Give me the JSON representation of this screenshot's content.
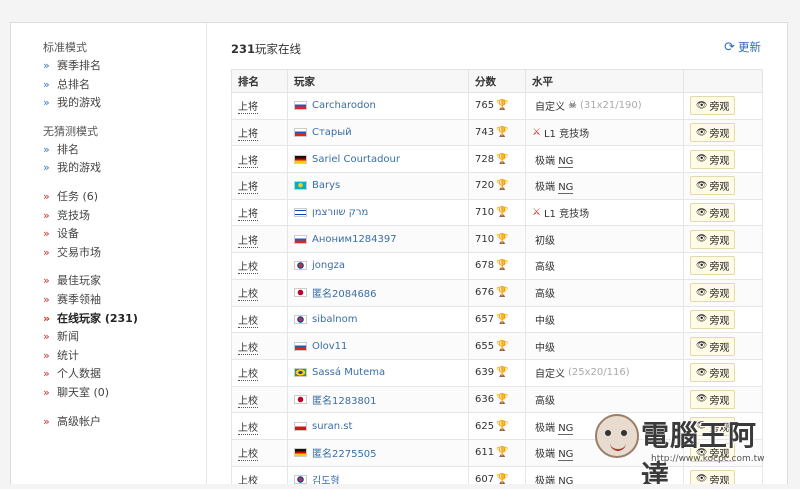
{
  "sidebar": {
    "groups": [
      {
        "title": "标准模式",
        "items": [
          {
            "label": "赛季排名",
            "bullet": "»"
          },
          {
            "label": "总排名",
            "bullet": "»"
          },
          {
            "label": "我的游戏",
            "bullet": "»"
          }
        ]
      },
      {
        "title": "无猜测模式",
        "items": [
          {
            "label": "排名",
            "bullet": "»"
          },
          {
            "label": "我的游戏",
            "bullet": "»"
          }
        ]
      },
      {
        "title": "",
        "items": [
          {
            "label": "任务 (6)",
            "bullet": "»"
          },
          {
            "label": "竞技场",
            "bullet": "»"
          },
          {
            "label": "设备",
            "bullet": "»"
          },
          {
            "label": "交易市场",
            "bullet": "»"
          }
        ]
      },
      {
        "title": "",
        "items": [
          {
            "label": "最佳玩家",
            "bullet": "»"
          },
          {
            "label": "赛季领袖",
            "bullet": "»"
          },
          {
            "label": "在线玩家 (231)",
            "bullet": "»"
          },
          {
            "label": "新闻",
            "bullet": "»"
          },
          {
            "label": "统计",
            "bullet": "»"
          },
          {
            "label": "个人数据",
            "bullet": "»"
          },
          {
            "label": "聊天室 (0)",
            "bullet": "»"
          }
        ]
      },
      {
        "title": "",
        "items": [
          {
            "label": "高级帐户",
            "bullet": "»"
          }
        ]
      }
    ]
  },
  "main": {
    "count": "231",
    "title_suffix": "玩家在线",
    "refresh_label": "更新",
    "refresh_icon": "refresh-icon"
  },
  "table": {
    "headers": [
      "排名",
      "玩家",
      "分数",
      "水平",
      ""
    ],
    "watch_label": "旁观",
    "rows": [
      {
        "rank": "上将",
        "flag": "russia",
        "player": "Carcharodon",
        "score": "765",
        "level": "自定义",
        "level_icon": "skull",
        "level_extra": "(31x21/190)",
        "underline": false
      },
      {
        "rank": "上将",
        "flag": "russia",
        "player": "Старый",
        "score": "743",
        "level": "L1 竞技场",
        "level_icon": "arena",
        "level_extra": "",
        "underline": false
      },
      {
        "rank": "上将",
        "flag": "germany",
        "player": "Sariel Courtadour",
        "score": "728",
        "level": "极端 NG",
        "level_icon": "",
        "level_extra": "",
        "underline": true
      },
      {
        "rank": "上将",
        "flag": "kazakhstan",
        "player": "Barys",
        "score": "720",
        "level": "极端 NG",
        "level_icon": "",
        "level_extra": "",
        "underline": true
      },
      {
        "rank": "上将",
        "flag": "israel",
        "player": "מרק שוורצמן",
        "score": "710",
        "level": "L1 竞技场",
        "level_icon": "arena",
        "level_extra": "",
        "underline": false
      },
      {
        "rank": "上将",
        "flag": "russia",
        "player": "Аноним1284397",
        "score": "710",
        "level": "初级",
        "level_icon": "",
        "level_extra": "",
        "underline": false
      },
      {
        "rank": "上校",
        "flag": "korea",
        "player": "jongza",
        "score": "678",
        "level": "高级",
        "level_icon": "",
        "level_extra": "",
        "underline": false
      },
      {
        "rank": "上校",
        "flag": "japan",
        "player": "匿名2084686",
        "score": "676",
        "level": "高级",
        "level_icon": "",
        "level_extra": "",
        "underline": false
      },
      {
        "rank": "上校",
        "flag": "korea",
        "player": "sibalnom",
        "score": "657",
        "level": "中级",
        "level_icon": "",
        "level_extra": "",
        "underline": false
      },
      {
        "rank": "上校",
        "flag": "russia",
        "player": "Olov11",
        "score": "655",
        "level": "中级",
        "level_icon": "",
        "level_extra": "",
        "underline": false
      },
      {
        "rank": "上校",
        "flag": "brazil",
        "player": "Sassá Mutema",
        "score": "639",
        "level": "自定义",
        "level_icon": "",
        "level_extra": "(25x20/116)",
        "underline": false
      },
      {
        "rank": "上校",
        "flag": "japan",
        "player": "匿名1283801",
        "score": "636",
        "level": "高级",
        "level_icon": "",
        "level_extra": "",
        "underline": false
      },
      {
        "rank": "上校",
        "flag": "czech",
        "player": "suran.st",
        "score": "625",
        "level": "极端 NG",
        "level_icon": "",
        "level_extra": "",
        "underline": true
      },
      {
        "rank": "上校",
        "flag": "germany",
        "player": "匿名2275505",
        "score": "611",
        "level": "极端 NG",
        "level_icon": "",
        "level_extra": "",
        "underline": true
      },
      {
        "rank": "上校",
        "flag": "korea",
        "player": "김도형",
        "score": "607",
        "level": "极端 NG",
        "level_icon": "",
        "level_extra": "",
        "underline": true
      }
    ]
  },
  "watermark": {
    "text": "電腦王阿達",
    "url": "http://www.kocpc.com.tw"
  }
}
